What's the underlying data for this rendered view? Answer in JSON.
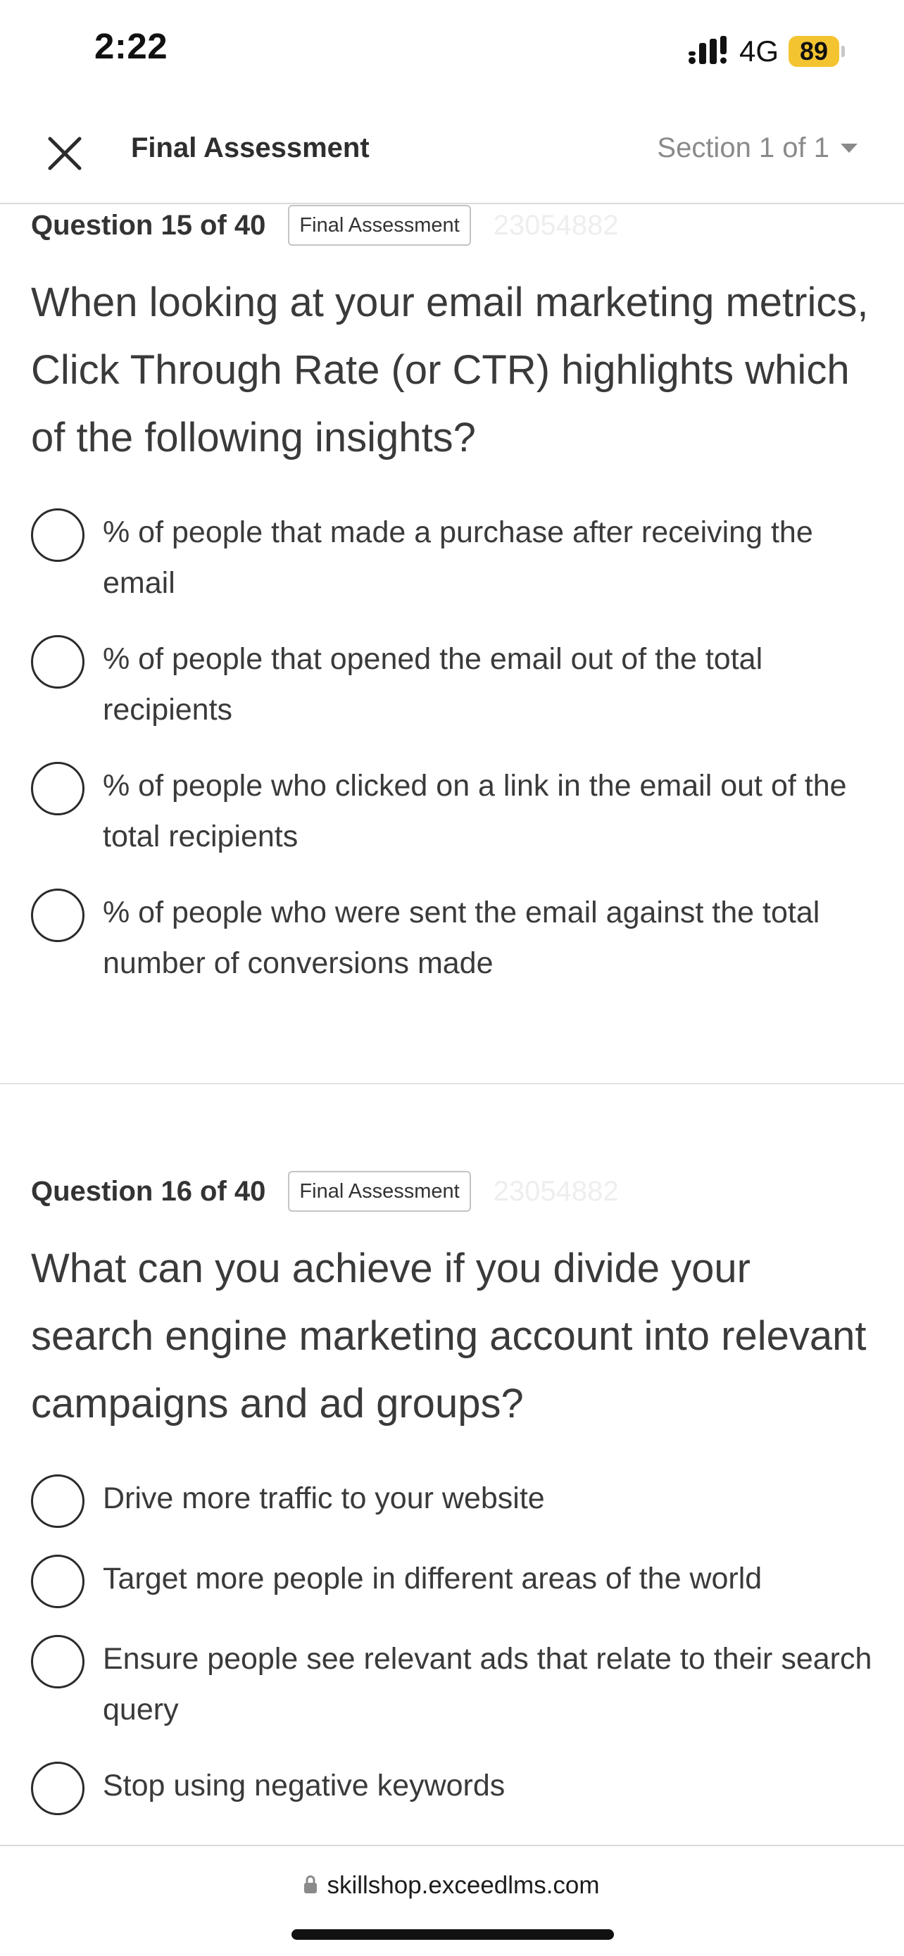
{
  "status_bar": {
    "time": "2:22",
    "network": "4G",
    "battery": "89",
    "icons": [
      "signal-icon",
      "battery-icon"
    ]
  },
  "header": {
    "title": "Final Assessment",
    "section_label": "Section 1 of 1",
    "close_icon": "close-icon",
    "dropdown_icon": "chevron-down-icon"
  },
  "questions": [
    {
      "number": "Question 15 of 40",
      "tag": "Final Assessment",
      "id": "23054882",
      "text": "When looking at your email marketing metrics, Click Through Rate (or CTR) highlights which of the following insights?",
      "options": [
        "% of people that made a purchase after receiving the email",
        "% of people that opened the email out of the total recipients",
        "% of people who clicked on a link in the email out of the total recipients",
        "% of people who were sent the email against the total number of conversions made"
      ]
    },
    {
      "number": "Question 16 of 40",
      "tag": "Final Assessment",
      "id": "23054882",
      "text": "What can you achieve if you divide your search engine marketing account into relevant campaigns and ad groups?",
      "options": [
        "Drive more traffic to your website",
        "Target more people in different areas of the world",
        "Ensure people see relevant ads that relate to their search query",
        "Stop using negative keywords"
      ]
    }
  ],
  "browser": {
    "url": "skillshop.exceedlms.com",
    "lock_icon": "lock-icon"
  },
  "colors": {
    "battery": "#f4c430",
    "text": "#3a3a3a",
    "muted": "#8a8a8a",
    "divider": "#e2e2e2"
  }
}
